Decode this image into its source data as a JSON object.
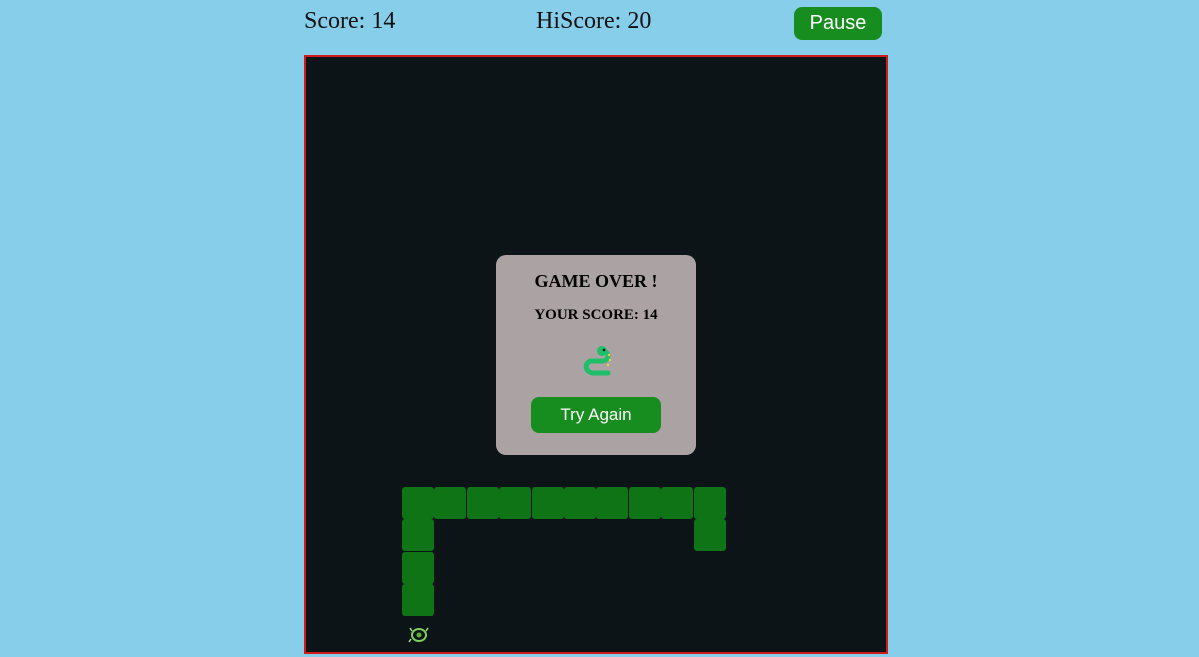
{
  "header": {
    "score_text": "Score: 14",
    "hiscore_text": "HiScore: 20",
    "pause_label": "Pause"
  },
  "game_over": {
    "title": "GAME OVER !",
    "score_text": "YOUR SCORE: 14",
    "icon": "snake-icon",
    "retry_label": "Try Again"
  },
  "board": {
    "food_icon": "food-icon",
    "snake_length": 14
  },
  "colors": {
    "page_background": "#87ceeb",
    "board_background": "#0d1418",
    "board_border": "#d11a1a",
    "snake": "#0e7416",
    "button": "#168d1e",
    "modal_background": "#aba2a3"
  }
}
